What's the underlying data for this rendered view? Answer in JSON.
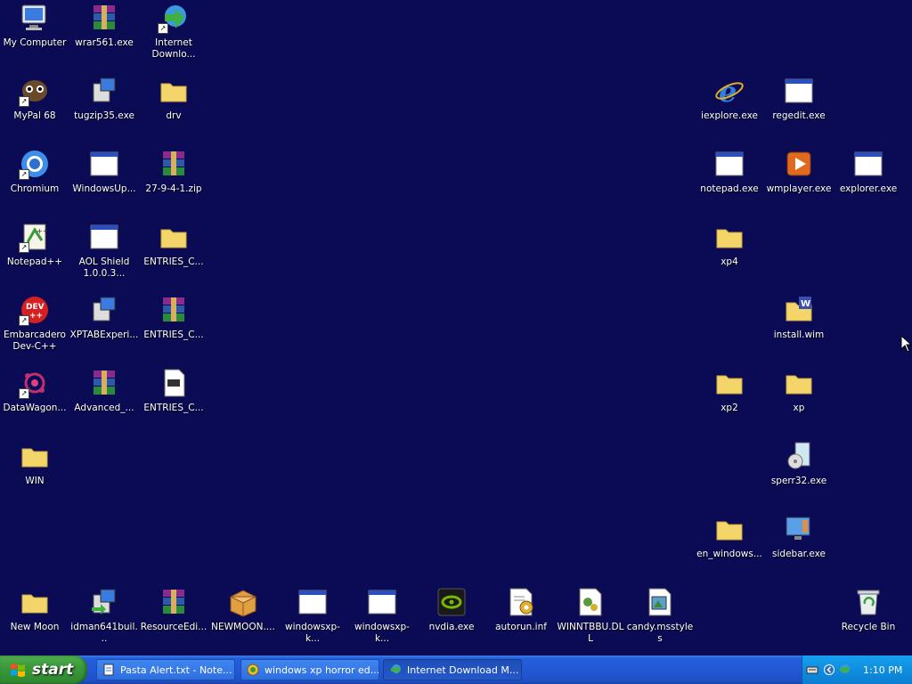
{
  "desktop": {
    "background_color": "#0a0a55",
    "icons": [
      {
        "label": "My Computer",
        "icon": "my-computer-icon"
      },
      {
        "label": "wrar561.exe",
        "icon": "winrar-icon"
      },
      {
        "label": "Internet Downlo...",
        "icon": "internet-download-manager-icon"
      },
      {
        "label": "MyPal 68",
        "icon": "mypal-icon"
      },
      {
        "label": "tugzip35.exe",
        "icon": "installer-icon"
      },
      {
        "label": "drv",
        "icon": "folder-icon"
      },
      {
        "label": "Chromium",
        "icon": "chromium-icon"
      },
      {
        "label": "WindowsUp...",
        "icon": "application-window-icon"
      },
      {
        "label": "27-9-4-1.zip",
        "icon": "winrar-archive-icon"
      },
      {
        "label": "Notepad++",
        "icon": "notepad-plus-plus-icon"
      },
      {
        "label": "AOL Shield 1.0.0.3...",
        "icon": "application-window-icon"
      },
      {
        "label": "ENTRIES_C...",
        "icon": "folder-icon"
      },
      {
        "label": "Embarcadero Dev-C++",
        "icon": "dev-cpp-icon"
      },
      {
        "label": "XPTABExperi...",
        "icon": "installer-icon"
      },
      {
        "label": "ENTRIES_C...",
        "icon": "winrar-archive-icon"
      },
      {
        "label": "DataWagon...",
        "icon": "datawagon-icon"
      },
      {
        "label": "Advanced_...",
        "icon": "winrar-archive-icon"
      },
      {
        "label": "ENTRIES_C...",
        "icon": "text-document-icon"
      },
      {
        "label": "WIN",
        "icon": "folder-icon"
      },
      {
        "label": "iexplore.exe",
        "icon": "internet-explorer-icon"
      },
      {
        "label": "regedit.exe",
        "icon": "application-window-icon"
      },
      {
        "label": "notepad.exe",
        "icon": "application-window-icon"
      },
      {
        "label": "wmplayer.exe",
        "icon": "media-player-icon"
      },
      {
        "label": "explorer.exe",
        "icon": "application-window-icon"
      },
      {
        "label": "xp4",
        "icon": "folder-icon"
      },
      {
        "label": "install.wim",
        "icon": "wim-folder-icon"
      },
      {
        "label": "xp2",
        "icon": "folder-icon"
      },
      {
        "label": "xp",
        "icon": "folder-icon"
      },
      {
        "label": "sperr32.exe",
        "icon": "setup-disc-icon"
      },
      {
        "label": "en_windows...",
        "icon": "folder-icon"
      },
      {
        "label": "sidebar.exe",
        "icon": "sidebar-icon"
      },
      {
        "label": "New Moon",
        "icon": "folder-icon"
      },
      {
        "label": "idman641buil...",
        "icon": "installer-icon"
      },
      {
        "label": "ResourceEdi...",
        "icon": "winrar-archive-icon"
      },
      {
        "label": "NEWMOON....",
        "icon": "package-icon"
      },
      {
        "label": "windowsxp-k...",
        "icon": "application-window-icon"
      },
      {
        "label": "windowsxp-k...",
        "icon": "application-window-icon"
      },
      {
        "label": "nvdia.exe",
        "icon": "nvidia-icon"
      },
      {
        "label": "autorun.inf",
        "icon": "settings-file-icon"
      },
      {
        "label": "WINNTBBU.DLL",
        "icon": "dll-file-icon"
      },
      {
        "label": "candy.msstyles",
        "icon": "msstyles-file-icon"
      },
      {
        "label": "Recycle Bin",
        "icon": "recycle-bin-icon"
      }
    ]
  },
  "taskbar": {
    "start_label": "start",
    "tasks": [
      {
        "label": "Pasta Alert.txt - Note...",
        "icon": "notepad-icon",
        "active": false
      },
      {
        "label": "windows xp horror ed...",
        "icon": "browser-icon",
        "active": false
      },
      {
        "label": "Internet Download M...",
        "icon": "internet-download-manager-icon",
        "active": true
      }
    ],
    "tray": {
      "clock": "1:10 PM"
    }
  },
  "colors": {
    "taskbar_blue": "#245edb",
    "start_green": "#3c9a3c",
    "tray_blue": "#0f8ee0"
  }
}
